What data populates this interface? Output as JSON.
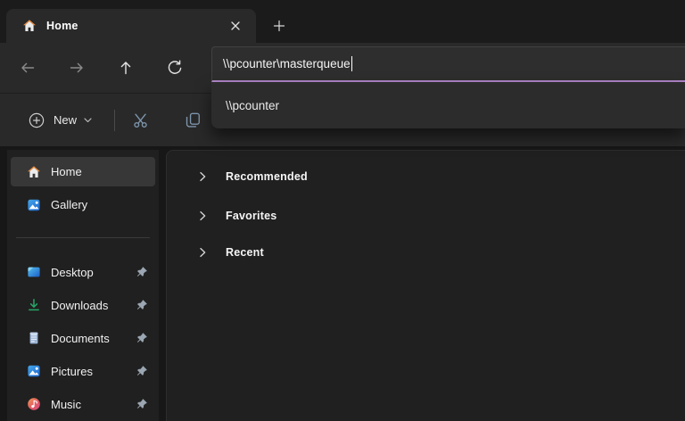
{
  "window": {
    "app": "File Explorer",
    "accent_underline": "#b085c9",
    "tool_icon_color": "#7e96ad"
  },
  "tab_bar": {
    "active_tab": {
      "label": "Home",
      "icon": "home-icon"
    },
    "close_icon": "close-icon",
    "new_tab_icon": "plus-icon"
  },
  "navigation": {
    "buttons": [
      {
        "name": "back",
        "icon": "arrow-left-icon",
        "enabled": false
      },
      {
        "name": "forward",
        "icon": "arrow-right-icon",
        "enabled": false
      },
      {
        "name": "up",
        "icon": "arrow-up-icon",
        "enabled": true
      },
      {
        "name": "refresh",
        "icon": "refresh-icon",
        "enabled": true
      }
    ],
    "address": {
      "value": "\\\\pcounter\\masterqueue"
    },
    "suggestions": [
      {
        "label": "\\\\pcounter"
      }
    ]
  },
  "toolbar": {
    "new_label": "New",
    "new_icon": "plus-circle-icon",
    "new_chevron": "chevron-down-icon",
    "buttons": [
      {
        "name": "cut",
        "icon": "scissors-icon"
      },
      {
        "name": "copy",
        "icon": "copy-icon"
      }
    ]
  },
  "sidebar": {
    "top": [
      {
        "label": "Home",
        "icon": "home-icon",
        "selected": true
      },
      {
        "label": "Gallery",
        "icon": "gallery-icon",
        "selected": false
      }
    ],
    "pinned": [
      {
        "label": "Desktop",
        "icon": "desktop-icon",
        "pin": "pin-icon"
      },
      {
        "label": "Downloads",
        "icon": "downloads-icon",
        "pin": "pin-icon"
      },
      {
        "label": "Documents",
        "icon": "documents-icon",
        "pin": "pin-icon"
      },
      {
        "label": "Pictures",
        "icon": "pictures-icon",
        "pin": "pin-icon"
      },
      {
        "label": "Music",
        "icon": "music-icon",
        "pin": "pin-icon"
      }
    ]
  },
  "main": {
    "sections": [
      {
        "label": "Recommended",
        "chevron": "chevron-right-icon",
        "expanded": false
      },
      {
        "label": "Favorites",
        "chevron": "chevron-right-icon",
        "expanded": false
      },
      {
        "label": "Recent",
        "chevron": "chevron-right-icon",
        "expanded": false
      }
    ]
  }
}
